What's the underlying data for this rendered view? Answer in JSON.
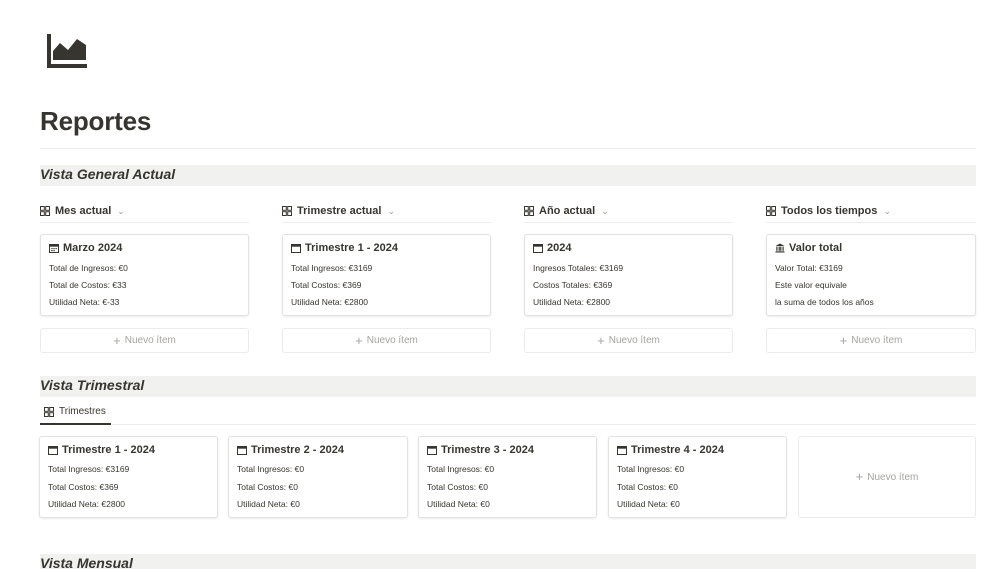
{
  "page": {
    "icon": "area-chart-icon",
    "title": "Reportes"
  },
  "vista_general": {
    "heading": "Vista General Actual",
    "columns": [
      {
        "tab_label": "Mes actual",
        "card": {
          "icon": "calendar-icon",
          "title": "Marzo 2024",
          "lines": [
            "Total de Ingresos: €0",
            "Total de Costos: €33",
            "Utilidad Neta: €-33"
          ]
        },
        "new_item": "Nuevo ítem"
      },
      {
        "tab_label": "Trimestre actual",
        "card": {
          "icon": "calendar-icon",
          "title": "Trimestre 1 - 2024",
          "lines": [
            "Total Ingresos: €3169",
            "Total Costos: €369",
            "Utilidad Neta: €2800"
          ]
        },
        "new_item": "Nuevo ítem"
      },
      {
        "tab_label": "Año actual",
        "card": {
          "icon": "calendar-icon",
          "title": "2024",
          "lines": [
            "Ingresos Totales: €3169",
            "Costos Totales: €369",
            "Utilidad Neta: €2800"
          ]
        },
        "new_item": "Nuevo ítem"
      },
      {
        "tab_label": "Todos los tiempos",
        "card": {
          "icon": "bank-icon",
          "title": "Valor total",
          "lines": [
            "Valor Total: €3169",
            "Este valor equivale",
            "la suma de todos los años"
          ]
        },
        "new_item": "Nuevo ítem"
      }
    ]
  },
  "vista_trimestral": {
    "heading": "Vista Trimestral",
    "tab_label": "Trimestres",
    "cards": [
      {
        "title": "Trimestre 1 - 2024",
        "lines": [
          "Total Ingresos: €3169",
          "Total Costos: €369",
          "Utilidad Neta: €2800"
        ]
      },
      {
        "title": "Trimestre 2 - 2024",
        "lines": [
          "Total Ingresos: €0",
          "Total Costos: €0",
          "Utilidad Neta: €0"
        ]
      },
      {
        "title": "Trimestre 3 - 2024",
        "lines": [
          "Total Ingresos: €0",
          "Total Costos: €0",
          "Utilidad Neta: €0"
        ]
      },
      {
        "title": "Trimestre 4 - 2024",
        "lines": [
          "Total Ingresos: €0",
          "Total Costos: €0",
          "Utilidad Neta: €0"
        ]
      }
    ],
    "new_item": "Nuevo ítem"
  },
  "vista_mensual": {
    "heading": "Vista Mensual"
  },
  "colors": {
    "text": "#37352f",
    "section_bg": "#f1f1ef",
    "muted": "#a5a4a1",
    "border": "#e3e2e0"
  }
}
